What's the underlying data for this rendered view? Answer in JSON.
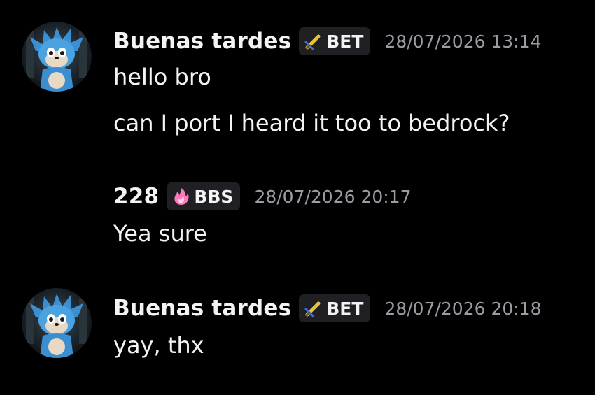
{
  "messages": [
    {
      "author": "Buenas tardes",
      "tag": {
        "icon": "sword-icon",
        "label": "BET"
      },
      "timestamp": "28/07/2026 13:14",
      "lines": [
        "hello bro",
        "can I port I heard it too to bedrock?"
      ],
      "avatar": "hedgehog-avatar"
    },
    {
      "author": "228",
      "tag": {
        "icon": "pink-flame-icon",
        "label": "BBS"
      },
      "timestamp": "28/07/2026 20:17",
      "lines": [
        "Yea sure"
      ]
    },
    {
      "author": "Buenas tardes",
      "tag": {
        "icon": "sword-icon",
        "label": "BET"
      },
      "timestamp": "28/07/2026 20:18",
      "lines": [
        "yay, thx"
      ],
      "avatar": "hedgehog-avatar"
    }
  ],
  "colors": {
    "background": "#000000",
    "text": "#f2f3f5",
    "timestamp": "#9a9ca3",
    "tag_background": "#1f1f24",
    "tag_sword": "#e8c23a",
    "tag_flame": "#ff7ab8"
  }
}
